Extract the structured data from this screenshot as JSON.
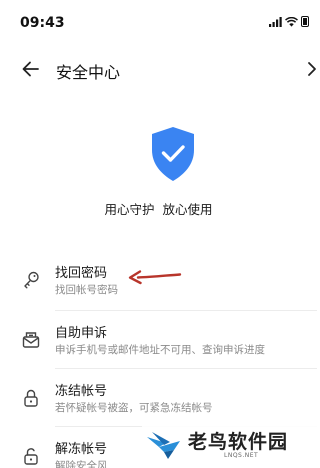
{
  "status_bar": {
    "time": "09:43"
  },
  "header": {
    "title": "安全中心"
  },
  "hero": {
    "slogan": "用心守护  放心使用",
    "shield_color": "#3a84f2"
  },
  "menu": [
    {
      "title": "找回密码",
      "subtitle": "找回帐号密码",
      "icon": "key-icon"
    },
    {
      "title": "自助申诉",
      "subtitle": "申诉手机号或邮件地址不可用、查询申诉进度",
      "icon": "appeal-envelope-icon"
    },
    {
      "title": "冻结帐号",
      "subtitle": "若怀疑帐号被盗，可紧急冻结帐号",
      "icon": "lock-icon"
    },
    {
      "title": "解冻帐号",
      "subtitle": "解除安全风",
      "icon": "unlock-icon"
    }
  ],
  "annotation": {
    "arrow_color": "#b8352b"
  },
  "watermark": {
    "name": "老鸟软件园",
    "domain": "LNQS.NET"
  }
}
